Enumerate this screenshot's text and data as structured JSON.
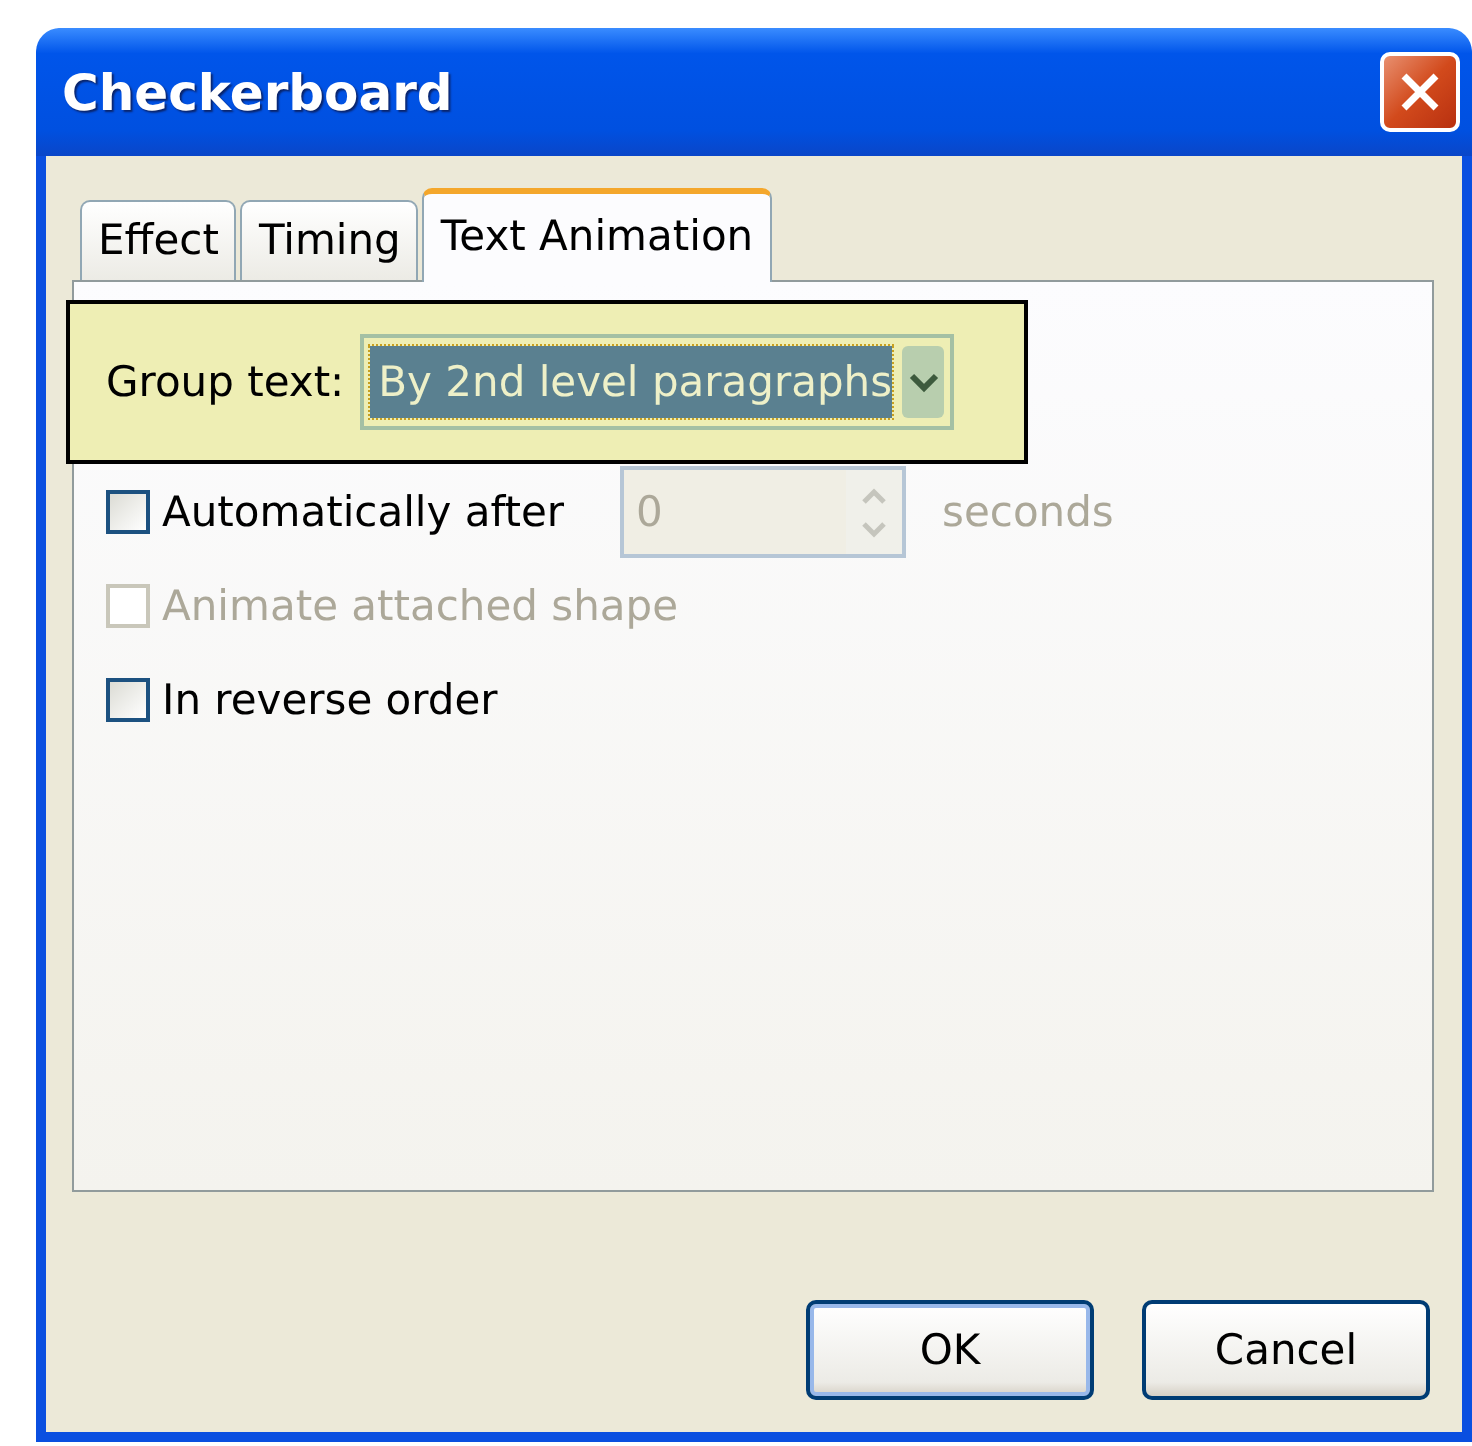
{
  "window": {
    "title": "Checkerboard"
  },
  "tabs": [
    {
      "label": "Effect",
      "selected": false
    },
    {
      "label": "Timing",
      "selected": false
    },
    {
      "label": "Text Animation",
      "selected": true
    }
  ],
  "group_text": {
    "label": "Group text:",
    "value": "By 2nd level paragraphs",
    "highlighted": true
  },
  "options": [
    {
      "kind": "checkbox-spin",
      "label": "Automatically after",
      "checked": false,
      "disabled": false,
      "spin": {
        "value": "0",
        "disabled": true,
        "unit": "seconds"
      }
    },
    {
      "kind": "checkbox",
      "label": "Animate attached shape",
      "checked": false,
      "disabled": true
    },
    {
      "kind": "checkbox",
      "label": "In reverse order",
      "checked": false,
      "disabled": false
    }
  ],
  "buttons": [
    {
      "label": "OK",
      "default": true
    },
    {
      "label": "Cancel",
      "default": false
    }
  ]
}
